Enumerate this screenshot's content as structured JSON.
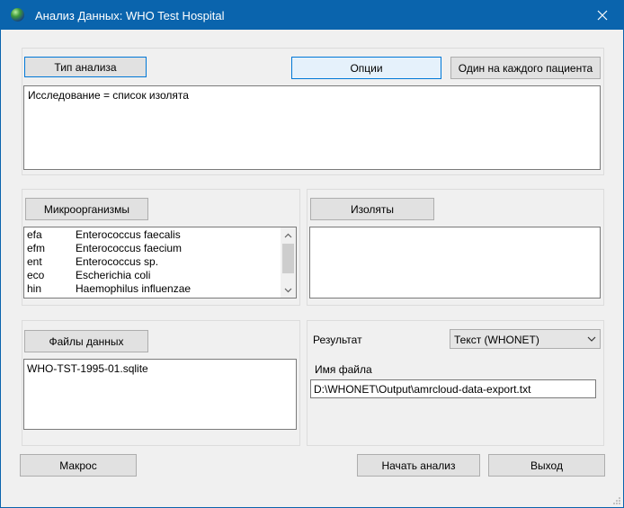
{
  "window": {
    "title": "Анализ Данных: WHO Test Hospital",
    "close_icon": "close-icon",
    "app_icon": "globe-icon"
  },
  "analysis": {
    "type_button": "Тип анализа",
    "options_button": "Опции",
    "per_patient_button": "Один на каждого пациента",
    "description": "Исследование = список изолята"
  },
  "organisms": {
    "button": "Микроорганизмы",
    "items": [
      {
        "code": "efa",
        "name": "Enterococcus faecalis"
      },
      {
        "code": "efm",
        "name": "Enterococcus faecium"
      },
      {
        "code": "ent",
        "name": "Enterococcus sp."
      },
      {
        "code": "eco",
        "name": "Escherichia coli"
      },
      {
        "code": "hin",
        "name": "Haemophilus influenzae"
      }
    ]
  },
  "isolates": {
    "button": "Изоляты"
  },
  "data_files": {
    "button": "Файлы данных",
    "items": [
      "WHO-TST-1995-01.sqlite"
    ]
  },
  "output": {
    "result_label": "Результат",
    "result_value": "Текст (WHONET)",
    "filename_label": "Имя файла",
    "filename_value": "D:\\WHONET\\Output\\amrcloud-data-export.txt"
  },
  "footer": {
    "macro_button": "Макрос",
    "start_button": "Начать анализ",
    "exit_button": "Выход"
  },
  "colors": {
    "titlebar": "#0a64ad",
    "accent": "#0078d7"
  }
}
